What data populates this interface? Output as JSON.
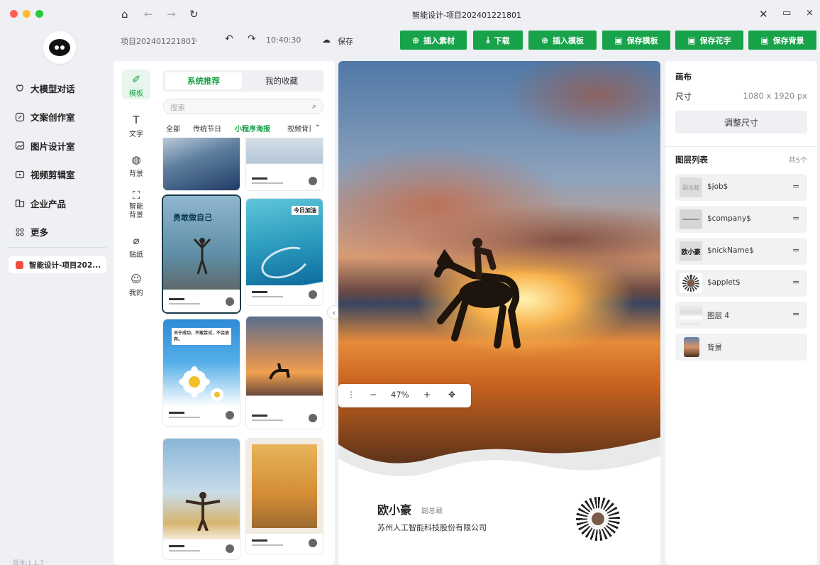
{
  "window": {
    "title": "智能设计-项目202401221801",
    "traffic_colors": [
      "#ff5f57",
      "#febc2e",
      "#28c840"
    ]
  },
  "sidebar": {
    "items": [
      {
        "label": "大模型对话",
        "icon": "brain-icon"
      },
      {
        "label": "文案创作室",
        "icon": "edit-icon"
      },
      {
        "label": "图片设计室",
        "icon": "image-icon"
      },
      {
        "label": "视频剪辑室",
        "icon": "video-icon"
      },
      {
        "label": "企业产品",
        "icon": "product-icon"
      },
      {
        "label": "更多",
        "icon": "more-grid-icon"
      }
    ],
    "project": "智能设计-项目202...",
    "version": "版本:1.1.7"
  },
  "toolbar": {
    "project_name": "项目202401221801",
    "time": "10:40:30",
    "save": "保存",
    "buttons": [
      "插入素材",
      "下载",
      "插入模板",
      "保存模板",
      "保存花字",
      "保存背景"
    ],
    "accent": "#18a34a"
  },
  "panel": {
    "rail": [
      "模板",
      "文字",
      "背景",
      "智能背景",
      "贴纸",
      "我的"
    ],
    "tabs": [
      "系统推荐",
      "我的收藏"
    ],
    "search_placeholder": "搜索",
    "categories": [
      "全部",
      "传统节日",
      "小程序海报",
      "视频背景"
    ],
    "active_category": "小程序海报",
    "templates": [
      {
        "label": ""
      },
      {
        "label": ""
      },
      {
        "label": "勇敢做自己"
      },
      {
        "label": "今日加油"
      },
      {
        "label": "关于成功，不敢尝试，不会放弃。"
      },
      {
        "label": ""
      },
      {
        "label": ""
      },
      {
        "label": ""
      }
    ]
  },
  "canvas": {
    "name": "欧小豪",
    "job": "副总裁",
    "company": "苏州人工智能科技股份有限公司",
    "zoom": "47%"
  },
  "props": {
    "title": "画布",
    "size_label": "尺寸",
    "size_value": "1080 x 1920 px",
    "resize": "调整尺寸",
    "layers_title": "图层列表",
    "layers_count": "共5个",
    "layers": [
      {
        "name": "$job$",
        "thumb": "副总裁"
      },
      {
        "name": "$company$",
        "thumb": ""
      },
      {
        "name": "$nickName$",
        "thumb": "欧小豪"
      },
      {
        "name": "$applet$",
        "thumb": ""
      },
      {
        "name": "图层 4",
        "thumb": ""
      },
      {
        "name": "背景",
        "thumb": ""
      }
    ]
  }
}
